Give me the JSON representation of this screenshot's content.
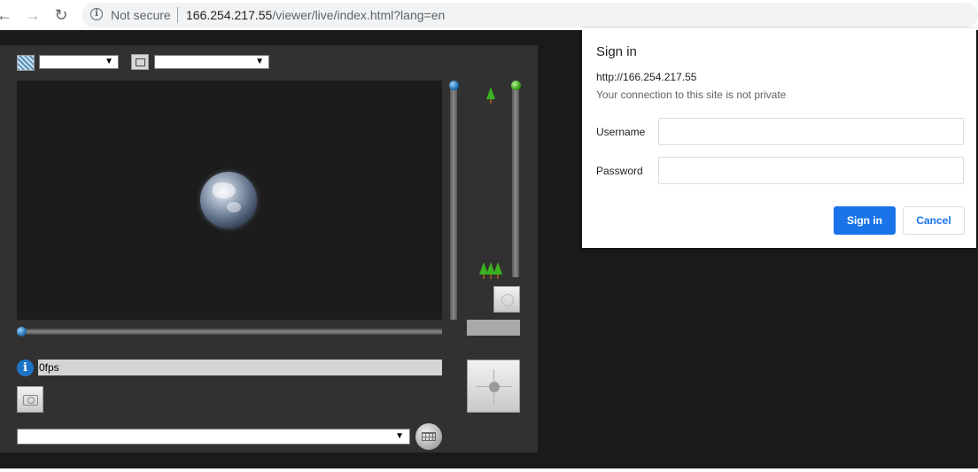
{
  "browser": {
    "back_icon": "arrow-left-icon",
    "forward_icon": "arrow-right-icon",
    "reload_icon": "reload-icon",
    "security_icon": "info-icon",
    "security_label": "Not secure",
    "url_host": "166.254.217.55",
    "url_path": "/viewer/live/index.html?lang=en"
  },
  "viewer": {
    "layout_icon": "grid-icon",
    "size_icon": "resize-icon",
    "layout_select_value": "",
    "size_select_value": "",
    "fps_text": "0fps",
    "info_icon": "info-icon",
    "snapshot_icon": "camera-icon",
    "preset_select_value": "",
    "keyboard_icon": "keyboard-icon",
    "zoom_wide_icon": "tree-icon",
    "zoom_tele_icon": "trees-icon",
    "focus_icon": "focus-icon",
    "ptz_icon": "ptz-pad-icon"
  },
  "signin_dialog": {
    "title": "Sign in",
    "host": "http://166.254.217.55",
    "warning": "Your connection to this site is not private",
    "username_label": "Username",
    "username_value": "",
    "password_label": "Password",
    "password_value": "",
    "signin_button": "Sign in",
    "cancel_button": "Cancel"
  },
  "colors": {
    "accent": "#1a73e8",
    "page_background": "#1a1a1a",
    "viewer_panel": "#313131"
  }
}
